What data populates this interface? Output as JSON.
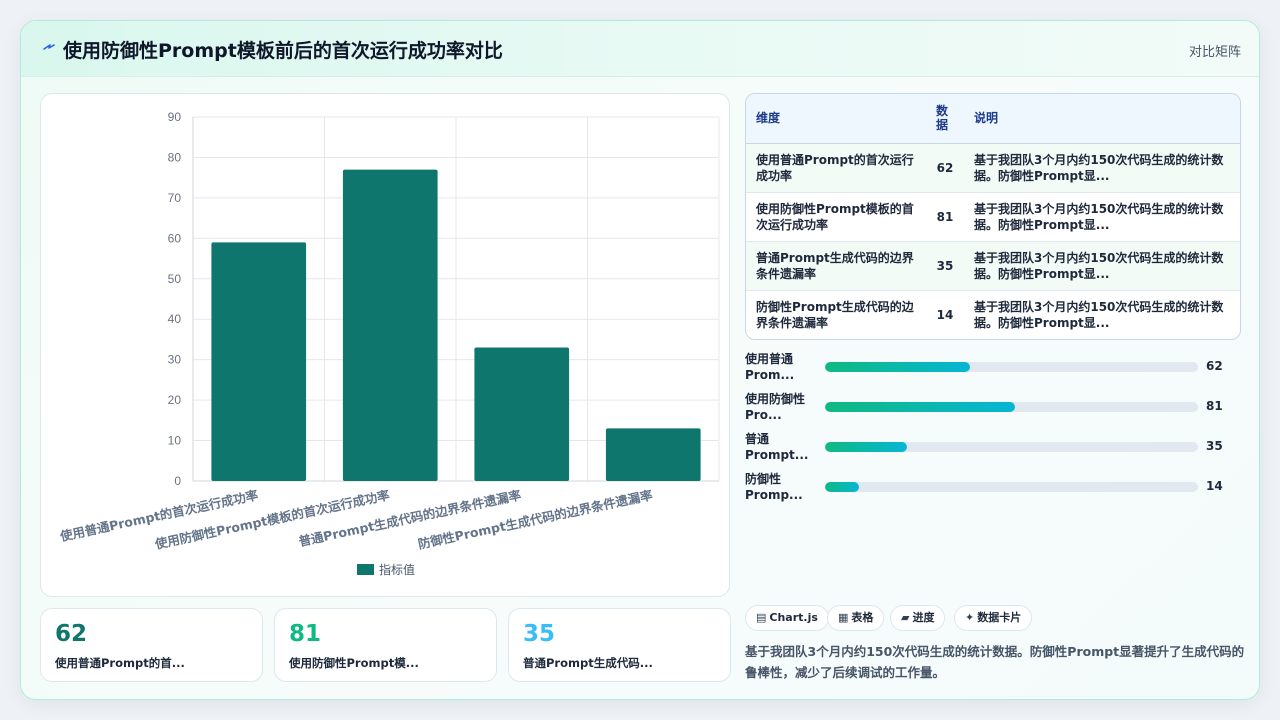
{
  "header": {
    "title": "使用防御性Prompt模板前后的首次运行成功率对比",
    "right_label": "对比矩阵",
    "icon": "lightning-icon"
  },
  "chart_data": {
    "type": "bar",
    "categories": [
      "使用普通Prompt的首次运行成功率",
      "使用防御性Prompt模板的首次运行成功率",
      "普通Prompt生成代码的边界条件遗漏率",
      "防御性Prompt生成代码的边界条件遗漏率"
    ],
    "series": [
      {
        "name": "指标值",
        "values": [
          59,
          77,
          33,
          13
        ],
        "color": "#0f766e"
      }
    ],
    "ylim": [
      0,
      90
    ],
    "yticks": [
      0,
      10,
      20,
      30,
      40,
      50,
      60,
      70,
      80,
      90
    ],
    "grid": true,
    "legend": "bottom"
  },
  "table": {
    "headers": {
      "dimension": "维度",
      "value": "数据",
      "note": "说明"
    },
    "rows": [
      {
        "dimension": "使用普通Prompt的首次运行成功率",
        "value": "62",
        "note": "基于我团队3个月内约150次代码生成的统计数据。防御性Prompt显..."
      },
      {
        "dimension": "使用防御性Prompt模板的首次运行成功率",
        "value": "81",
        "note": "基于我团队3个月内约150次代码生成的统计数据。防御性Prompt显..."
      },
      {
        "dimension": "普通Prompt生成代码的边界条件遗漏率",
        "value": "35",
        "note": "基于我团队3个月内约150次代码生成的统计数据。防御性Prompt显..."
      },
      {
        "dimension": "防御性Prompt生成代码的边界条件遗漏率",
        "value": "14",
        "note": "基于我团队3个月内约150次代码生成的统计数据。防御性Prompt显..."
      }
    ]
  },
  "progress": [
    {
      "line1": "使用普通",
      "line2": "Prom...",
      "value": "62",
      "fraction": 0.39
    },
    {
      "line1": "使用防御性",
      "line2": "Pro...",
      "value": "81",
      "fraction": 0.51
    },
    {
      "line1": "普通",
      "line2": "Prompt...",
      "value": "35",
      "fraction": 0.22
    },
    {
      "line1": "防御性",
      "line2": "Promp...",
      "value": "14",
      "fraction": 0.09
    }
  ],
  "stats": [
    {
      "value": "62",
      "label": "使用普通Prompt的首...",
      "color": "#0f766e"
    },
    {
      "value": "81",
      "label": "使用防御性Prompt模...",
      "color": "#10b981"
    },
    {
      "value": "35",
      "label": "普通Prompt生成代码...",
      "color": "#38bdf8"
    }
  ],
  "tags": [
    {
      "icon": "chart-icon",
      "glyph": "▤",
      "label": "Chart.js"
    },
    {
      "icon": "table-icon",
      "glyph": "▦",
      "label": "表格"
    },
    {
      "icon": "progress-icon",
      "glyph": "▰",
      "label": "进度"
    },
    {
      "icon": "sparkle-icon",
      "glyph": "✦",
      "label": "数据卡片"
    }
  ],
  "description": "基于我团队3个月内约150次代码生成的统计数据。防御性Prompt显著提升了生成代码的鲁棒性，减少了后续调试的工作量。"
}
